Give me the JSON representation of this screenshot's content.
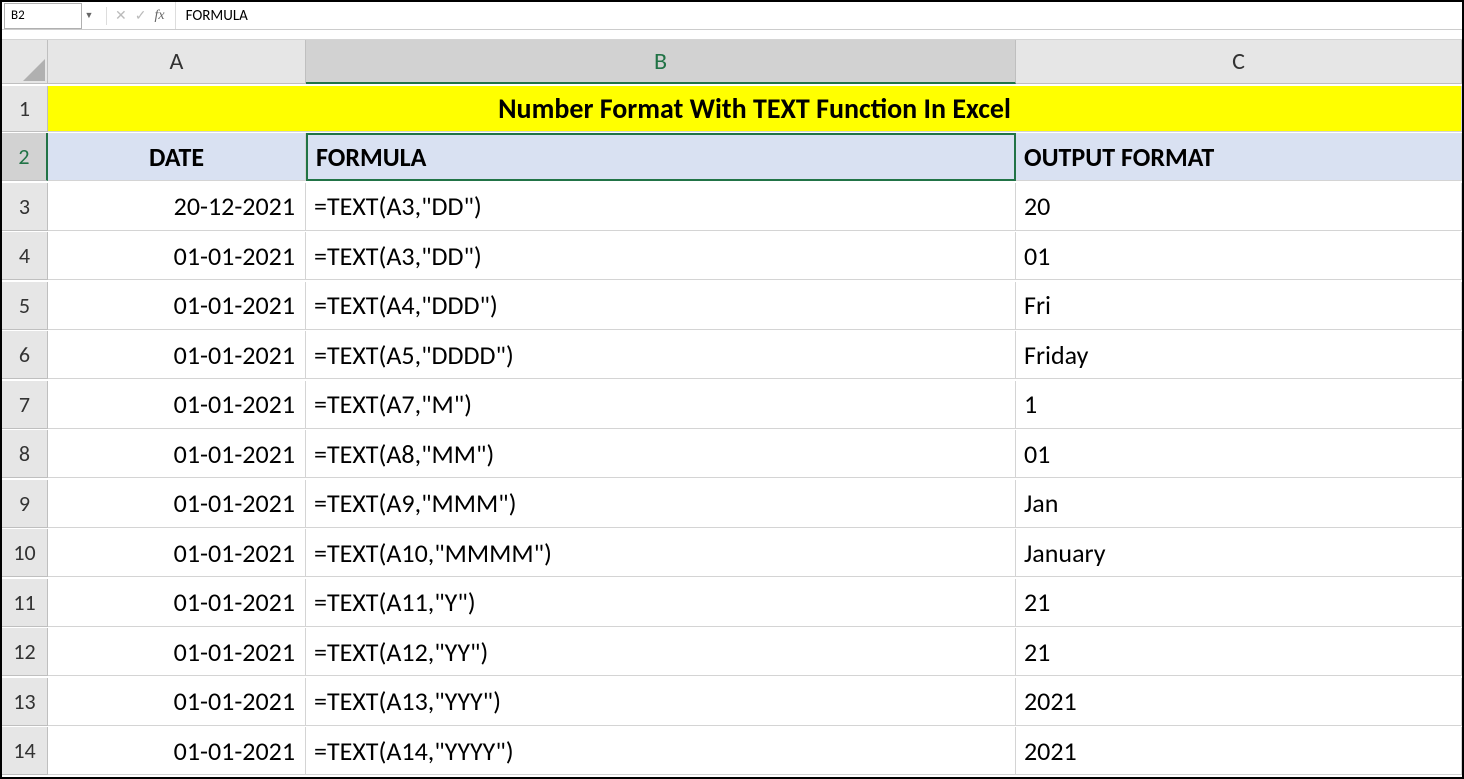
{
  "nameBox": "B2",
  "formulaBarValue": "FORMULA",
  "columns": [
    "A",
    "B",
    "C"
  ],
  "rowNumbers": [
    "1",
    "2",
    "3",
    "4",
    "5",
    "6",
    "7",
    "8",
    "9",
    "10",
    "11",
    "12",
    "13",
    "14"
  ],
  "title": "Number Format With TEXT Function In Excel",
  "headers": {
    "A": "DATE",
    "B": "FORMULA",
    "C": "OUTPUT FORMAT"
  },
  "selectedCell": "B2",
  "rows": [
    {
      "date": "20-12-2021",
      "formula": "=TEXT(A3,\"DD\")",
      "output": "20"
    },
    {
      "date": "01-01-2021",
      "formula": "=TEXT(A3,\"DD\")",
      "output": "01"
    },
    {
      "date": "01-01-2021",
      "formula": "=TEXT(A4,\"DDD\")",
      "output": "Fri"
    },
    {
      "date": "01-01-2021",
      "formula": "=TEXT(A5,\"DDDD\")",
      "output": "Friday"
    },
    {
      "date": "01-01-2021",
      "formula": "=TEXT(A7,\"M\")",
      "output": "1"
    },
    {
      "date": "01-01-2021",
      "formula": "=TEXT(A8,\"MM\")",
      "output": "01"
    },
    {
      "date": "01-01-2021",
      "formula": "=TEXT(A9,\"MMM\")",
      "output": "Jan"
    },
    {
      "date": "01-01-2021",
      "formula": "=TEXT(A10,\"MMMM\")",
      "output": "January"
    },
    {
      "date": "01-01-2021",
      "formula": "=TEXT(A11,\"Y\")",
      "output": "21"
    },
    {
      "date": "01-01-2021",
      "formula": "=TEXT(A12,\"YY\")",
      "output": "21"
    },
    {
      "date": "01-01-2021",
      "formula": "=TEXT(A13,\"YYY\")",
      "output": "2021"
    },
    {
      "date": "01-01-2021",
      "formula": "=TEXT(A14,\"YYYY\")",
      "output": "2021"
    }
  ]
}
